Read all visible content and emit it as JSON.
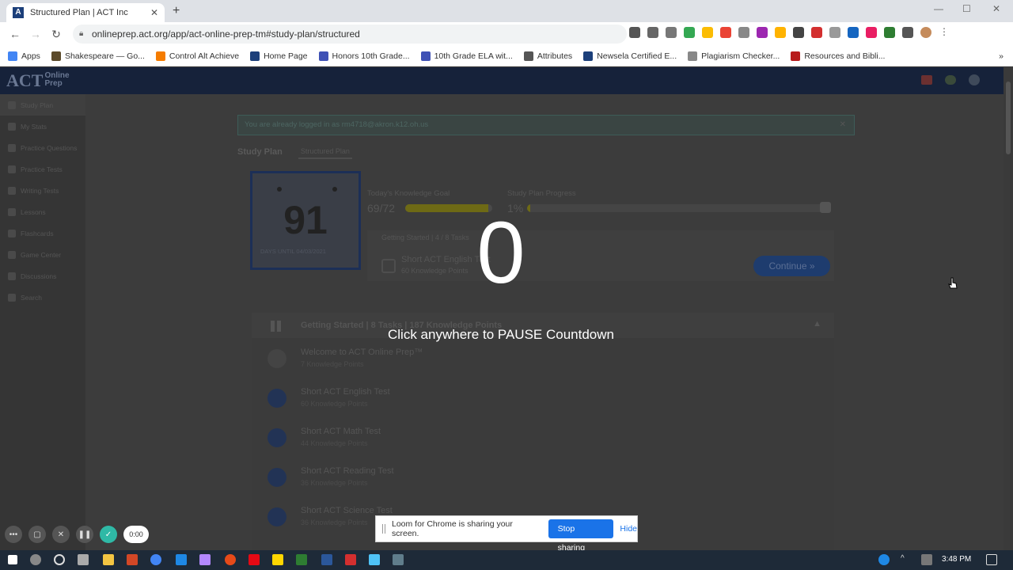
{
  "browser": {
    "tab_title": "Structured Plan | ACT Inc",
    "tab_favicon": "A",
    "url": "onlineprep.act.org/app/act-online-prep-tm#study-plan/structured",
    "new_tab": "+"
  },
  "bookmarks": [
    {
      "label": "Apps",
      "color": "#4285f4"
    },
    {
      "label": "Shakespeare — Go...",
      "color": "#5b4a2a"
    },
    {
      "label": "Control Alt Achieve",
      "color": "#f57c00"
    },
    {
      "label": "Home Page",
      "color": "#1c3f7a"
    },
    {
      "label": "Honors 10th Grade...",
      "color": "#3f51b5"
    },
    {
      "label": "10th Grade ELA wit...",
      "color": "#3f51b5"
    },
    {
      "label": "Attributes",
      "color": "#555555"
    },
    {
      "label": "Newsela Certified E...",
      "color": "#1c3f7a"
    },
    {
      "label": "Plagiarism Checker...",
      "color": "#888888"
    },
    {
      "label": "Resources and Bibli...",
      "color": "#b71c1c"
    }
  ],
  "app": {
    "logo_text": "ACT",
    "logo_sub1": "Online",
    "logo_sub2": "Prep",
    "sidebar": [
      {
        "label": "Study Plan",
        "active": true
      },
      {
        "label": "My Stats"
      },
      {
        "label": "Practice Questions"
      },
      {
        "label": "Practice Tests"
      },
      {
        "label": "Writing Tests"
      },
      {
        "label": "Lessons"
      },
      {
        "label": "Flashcards"
      },
      {
        "label": "Game Center"
      },
      {
        "label": "Discussions"
      },
      {
        "label": "Search"
      }
    ],
    "alert": "You are already logged in as rm4718@akron.k12.oh.us",
    "tabs": {
      "main": "Study Plan",
      "sub": "Structured Plan"
    },
    "days_card": {
      "number": "91",
      "label": "DAYS UNTIL 04/03/2021"
    },
    "goal": {
      "label": "Today's Knowledge Goal",
      "value": "69/72",
      "fraction": 0.958
    },
    "progress": {
      "label": "Study Plan Progress",
      "value": "1%",
      "fraction": 0.01
    },
    "current_task": {
      "header": "Getting Started | 4 / 8 Tasks",
      "name": "Short ACT English Test",
      "points": "60 Knowledge Points"
    },
    "continue_label": "Continue »",
    "section": {
      "title": "Getting Started | 8 Tasks | 187 Knowledge Points",
      "items": [
        {
          "name": "Welcome to ACT Online Prep™",
          "points": "7 Knowledge Points"
        },
        {
          "name": "Short ACT English Test",
          "points": "60 Knowledge Points"
        },
        {
          "name": "Short ACT Math Test",
          "points": "44 Knowledge Points"
        },
        {
          "name": "Short ACT Reading Test",
          "points": "36 Knowledge Points"
        },
        {
          "name": "Short ACT Science Test",
          "points": "36 Knowledge Points"
        }
      ]
    }
  },
  "overlay": {
    "countdown": "0",
    "message": "Click anywhere to PAUSE Countdown"
  },
  "loom": {
    "timer": "0:00",
    "share_text": "Loom for Chrome is sharing your screen.",
    "stop_label": "Stop sharing",
    "hide_label": "Hide"
  },
  "taskbar": {
    "time": "3:48 PM"
  }
}
